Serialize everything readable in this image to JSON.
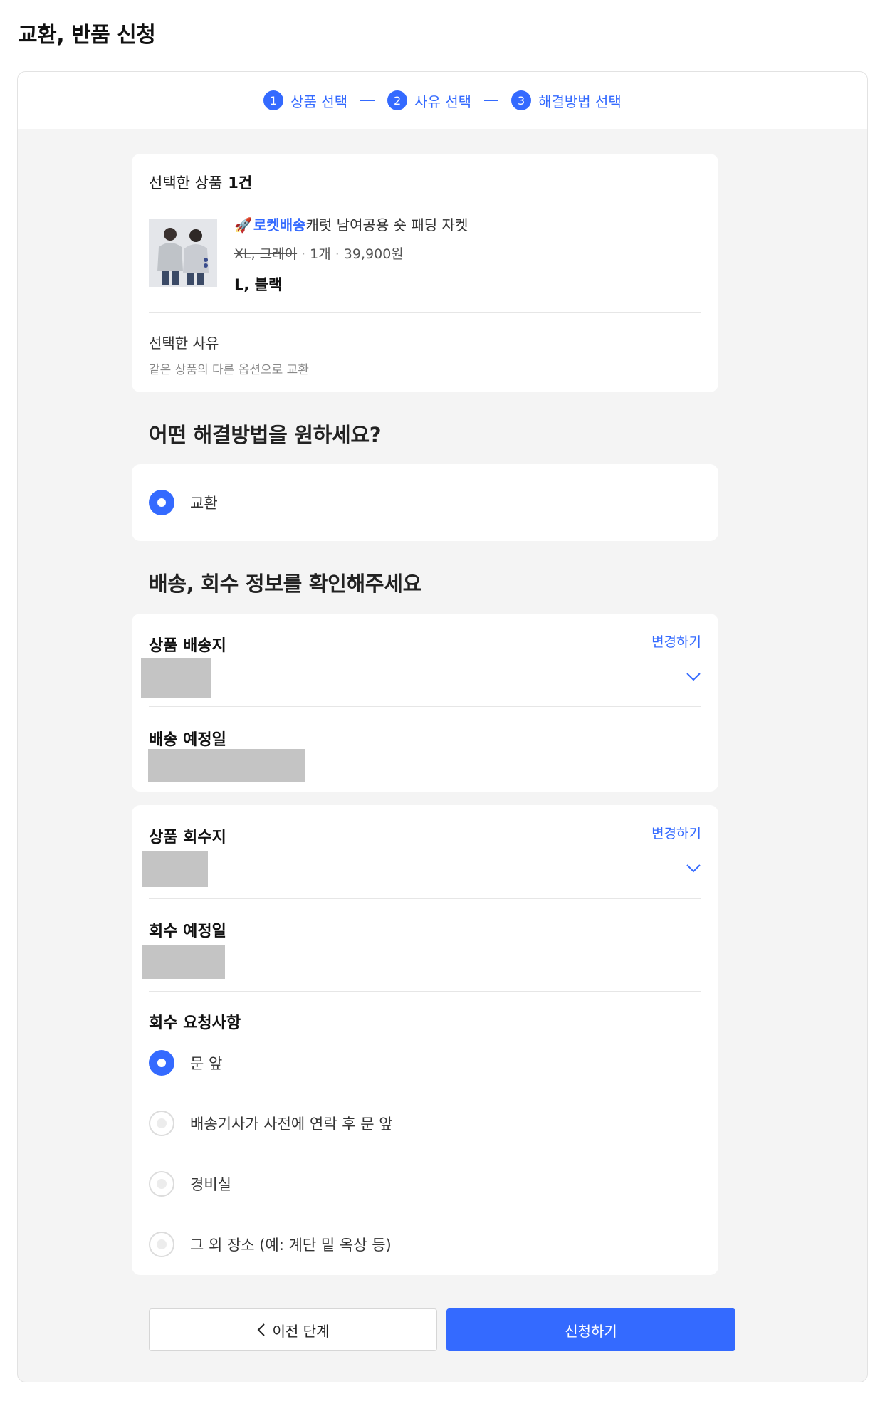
{
  "page": {
    "title": "교환, 반품 신청"
  },
  "stepper": {
    "steps": [
      {
        "num": "1",
        "label": "상품 선택"
      },
      {
        "num": "2",
        "label": "사유 선택"
      },
      {
        "num": "3",
        "label": "해결방법 선택"
      }
    ]
  },
  "selected": {
    "title": "선택한 상품",
    "count": "1건",
    "product": {
      "badge": "로켓배송",
      "name": "캐럿 남여공용 숏 패딩 자켓",
      "old_option": "XL, 그레이",
      "qty": "1개",
      "price": "39,900원",
      "new_option": "L, 블랙"
    },
    "reason_label": "선택한 사유",
    "reason_value": "같은 상품의 다른 옵션으로 교환"
  },
  "resolution": {
    "heading": "어떤 해결방법을 원하세요?",
    "option": "교환"
  },
  "shipping": {
    "heading": "배송, 회수 정보를 확인해주세요",
    "delivery_label": "상품 배송지",
    "change_label": "변경하기",
    "delivery_date_label": "배송 예정일",
    "pickup_label": "상품 회수지",
    "pickup_date_label": "회수 예정일",
    "request_label": "회수 요청사항",
    "request_options": [
      "문 앞",
      "배송기사가 사전에 연락 후 문 앞",
      "경비실",
      "그 외 장소 (예: 계단 밑 옥상 등)"
    ],
    "selected_request": "문 앞"
  },
  "buttons": {
    "prev": "이전 단계",
    "submit": "신청하기"
  },
  "colors": {
    "accent": "#346aff",
    "background": "#f4f4f4",
    "redacted": "#c4c4c4"
  },
  "icons": {
    "step": "circle-number-icon",
    "rocket": "rocket-icon",
    "chevron": "chevron-down-icon",
    "back": "chevron-left-icon"
  }
}
